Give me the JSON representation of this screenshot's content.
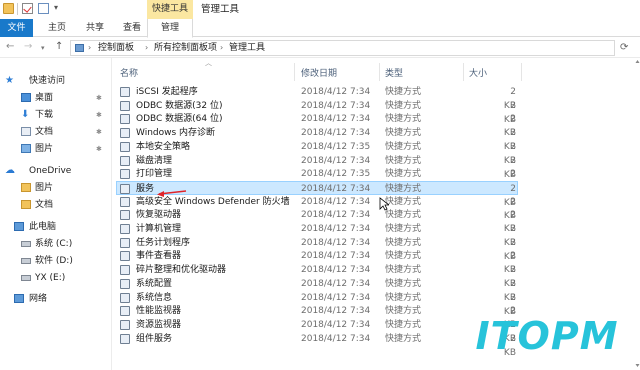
{
  "titlebar": {
    "contextual_tab_group": "快捷工具",
    "window_title": "管理工具"
  },
  "ribbon": {
    "tabs": [
      "文件",
      "主页",
      "共享",
      "查看",
      "管理"
    ]
  },
  "address": {
    "breadcrumbs": [
      "控制面板",
      "所有控制面板项",
      "管理工具"
    ]
  },
  "sidebar": {
    "items": [
      {
        "label": "快速访问",
        "icon": "star-icon"
      },
      {
        "label": "桌面",
        "icon": "desktop-icon",
        "pinned": true
      },
      {
        "label": "下载",
        "icon": "download-icon",
        "pinned": true
      },
      {
        "label": "文档",
        "icon": "documents-icon",
        "pinned": true
      },
      {
        "label": "图片",
        "icon": "pictures-icon",
        "pinned": true
      },
      {
        "label": "OneDrive",
        "icon": "cloud-icon"
      },
      {
        "label": "图片",
        "icon": "folder-icon"
      },
      {
        "label": "文档",
        "icon": "folder-icon"
      },
      {
        "label": "此电脑",
        "icon": "computer-icon"
      },
      {
        "label": "系统 (C:)",
        "icon": "drive-icon"
      },
      {
        "label": "软件 (D:)",
        "icon": "drive-icon"
      },
      {
        "label": "YX (E:)",
        "icon": "drive-icon"
      },
      {
        "label": "网络",
        "icon": "network-icon"
      }
    ]
  },
  "columns": [
    "名称",
    "修改日期",
    "类型",
    "大小"
  ],
  "files": [
    {
      "name": "iSCSI 发起程序",
      "date": "2018/4/12 7:34",
      "type": "快捷方式",
      "size": "2 KB"
    },
    {
      "name": "ODBC 数据源(32 位)",
      "date": "2018/4/12 7:34",
      "type": "快捷方式",
      "size": "2 KB"
    },
    {
      "name": "ODBC 数据源(64 位)",
      "date": "2018/4/12 7:34",
      "type": "快捷方式",
      "size": "2 KB"
    },
    {
      "name": "Windows 内存诊断",
      "date": "2018/4/12 7:34",
      "type": "快捷方式",
      "size": "2 KB"
    },
    {
      "name": "本地安全策略",
      "date": "2018/4/12 7:35",
      "type": "快捷方式",
      "size": "2 KB"
    },
    {
      "name": "磁盘清理",
      "date": "2018/4/12 7:34",
      "type": "快捷方式",
      "size": "2 KB"
    },
    {
      "name": "打印管理",
      "date": "2018/4/12 7:35",
      "type": "快捷方式",
      "size": "2 KB"
    },
    {
      "name": "服务",
      "date": "2018/4/12 7:34",
      "type": "快捷方式",
      "size": "2 KB",
      "selected": true
    },
    {
      "name": "高级安全 Windows Defender 防火墙",
      "date": "2018/4/12 7:34",
      "type": "快捷方式",
      "size": "2 KB"
    },
    {
      "name": "恢复驱动器",
      "date": "2018/4/12 7:34",
      "type": "快捷方式",
      "size": "2 KB"
    },
    {
      "name": "计算机管理",
      "date": "2018/4/12 7:34",
      "type": "快捷方式",
      "size": "2 KB"
    },
    {
      "name": "任务计划程序",
      "date": "2018/4/12 7:34",
      "type": "快捷方式",
      "size": "2 KB"
    },
    {
      "name": "事件查看器",
      "date": "2018/4/12 7:34",
      "type": "快捷方式",
      "size": "2 KB"
    },
    {
      "name": "碎片整理和优化驱动器",
      "date": "2018/4/12 7:34",
      "type": "快捷方式",
      "size": "2 KB"
    },
    {
      "name": "系统配置",
      "date": "2018/4/12 7:34",
      "type": "快捷方式",
      "size": "2 KB"
    },
    {
      "name": "系统信息",
      "date": "2018/4/12 7:34",
      "type": "快捷方式",
      "size": "2 KB"
    },
    {
      "name": "性能监视器",
      "date": "2018/4/12 7:34",
      "type": "快捷方式",
      "size": "2 KB"
    },
    {
      "name": "资源监视器",
      "date": "2018/4/12 7:34",
      "type": "快捷方式",
      "size": "2 KB"
    },
    {
      "name": "组件服务",
      "date": "2018/4/12 7:34",
      "type": "快捷方式",
      "size": "2 KB"
    }
  ],
  "watermark": "ITOPM",
  "colors": {
    "accent": "#1979ca",
    "selection": "#cce8ff",
    "contextual_tab": "#fbe7a1",
    "annotation_arrow": "#e0242a",
    "watermark": "#27c3da"
  }
}
